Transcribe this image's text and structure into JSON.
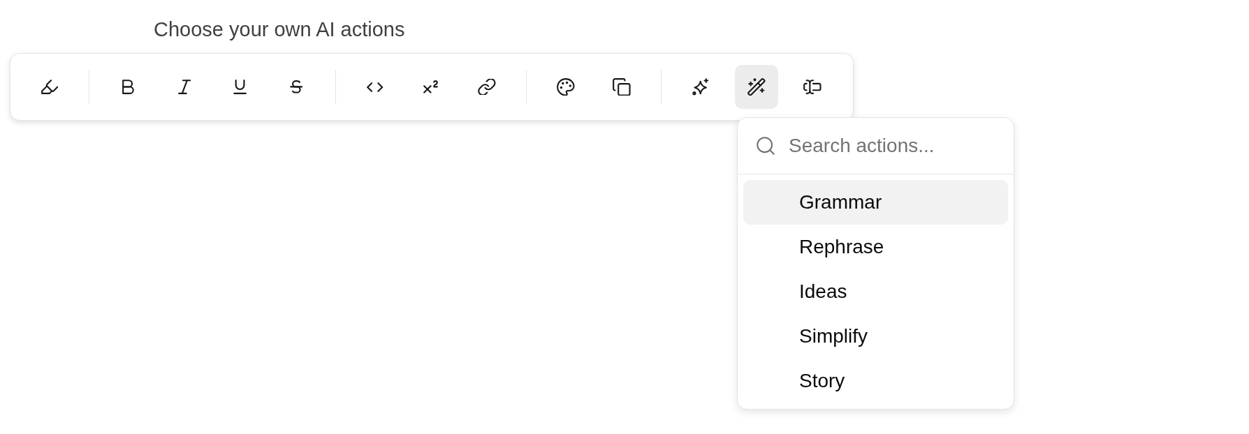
{
  "heading": "Choose your own AI actions",
  "toolbar": {
    "groups": [
      {
        "buttons": [
          {
            "kind": "highlight",
            "expanded": false
          }
        ]
      },
      {
        "buttons": [
          {
            "kind": "bold",
            "expanded": false
          },
          {
            "kind": "italic",
            "expanded": false
          },
          {
            "kind": "underline",
            "expanded": false
          },
          {
            "kind": "strike",
            "expanded": false
          }
        ]
      },
      {
        "buttons": [
          {
            "kind": "code",
            "expanded": false
          },
          {
            "kind": "superscript",
            "expanded": false
          },
          {
            "kind": "link",
            "expanded": false
          }
        ]
      },
      {
        "buttons": [
          {
            "kind": "palette",
            "expanded": false
          },
          {
            "kind": "copy",
            "expanded": false
          }
        ]
      },
      {
        "buttons": [
          {
            "kind": "sparkles",
            "expanded": false
          },
          {
            "kind": "wand",
            "expanded": true,
            "menu": {
              "search": {
                "placeholder": "Search actions..."
              },
              "items": [
                {
                  "label": "Grammar",
                  "selected": true
                },
                {
                  "label": "Rephrase",
                  "selected": false
                },
                {
                  "label": "Ideas",
                  "selected": false
                },
                {
                  "label": "Simplify",
                  "selected": false
                },
                {
                  "label": "Story",
                  "selected": false
                }
              ]
            }
          },
          {
            "kind": "textinput",
            "expanded": false
          }
        ]
      }
    ]
  }
}
